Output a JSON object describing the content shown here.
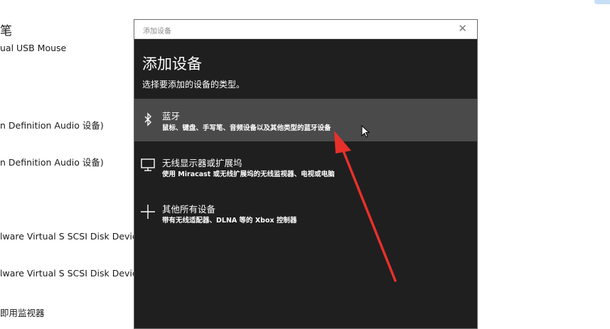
{
  "background_list": {
    "items": [
      {
        "text": "笔"
      },
      {
        "text": "ual USB Mouse"
      },
      {
        "text": "n Definition Audio 设备)"
      },
      {
        "text": "n Definition Audio 设备)"
      },
      {
        "text": "lware Virtual S SCSI Disk Device"
      },
      {
        "text": "lware Virtual S SCSI Disk Device"
      },
      {
        "text": "即用监视器"
      }
    ]
  },
  "dialog": {
    "window_title": "添加设备",
    "close_icon": "close-icon",
    "heading": "添加设备",
    "subheading": "选择要添加的设备的类型。",
    "options": [
      {
        "icon": "bluetooth-icon",
        "label": "蓝牙",
        "description": "鼠标、键盘、手写笔、音频设备以及其他类型的蓝牙设备",
        "selected": true
      },
      {
        "icon": "monitor-icon",
        "label": "无线显示器或扩展坞",
        "description": "使用 Miracast 或无线扩展坞的无线监视器、电视或电脑",
        "selected": false
      },
      {
        "icon": "plus-icon",
        "label": "其他所有设备",
        "description": "带有无线适配器、DLNA 等的 Xbox 控制器",
        "selected": false
      }
    ]
  },
  "colors": {
    "dialog_bg": "#1f1f1f",
    "selected_bg": "#4a4a4a",
    "annotation_arrow": "#e8302b"
  }
}
